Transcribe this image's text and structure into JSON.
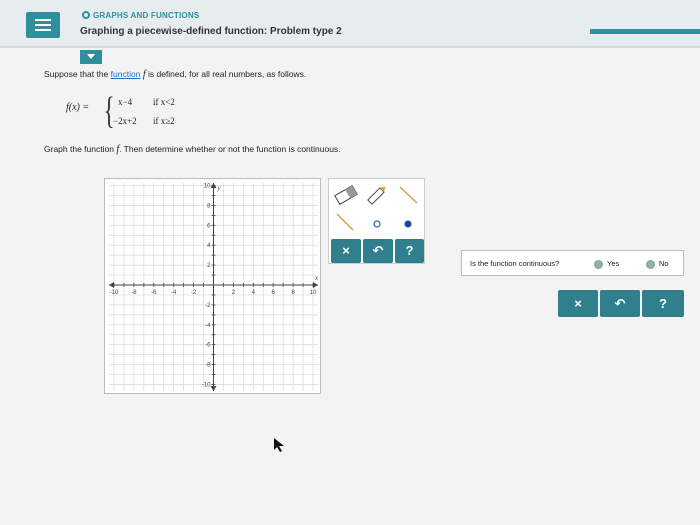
{
  "header": {
    "category": "GRAPHS AND FUNCTIONS",
    "title": "Graphing a piecewise-defined function: Problem type 2"
  },
  "problem": {
    "intro_pre": "Suppose that the",
    "intro_link": "function",
    "intro_var": "f",
    "intro_post": "is defined, for all real numbers, as follows.",
    "fx_label": "f(x) =",
    "piece1_expr": "x−4",
    "piece1_cond": "if x<2",
    "piece2_expr": "−2x+2",
    "piece2_cond": "if x≥2",
    "instruction_pre": "Graph the function",
    "instruction_var": "f",
    "instruction_post": ". Then determine whether or not the function is continuous."
  },
  "graph": {
    "x_axis_label": "x",
    "y_axis_label": "y",
    "x_ticks": [
      "-10",
      "-8",
      "-6",
      "-4",
      "-2",
      "2",
      "4",
      "6",
      "8",
      "10"
    ],
    "y_ticks": [
      "10",
      "8",
      "6",
      "4",
      "2",
      "-2",
      "-4",
      "-6",
      "-8",
      "-10"
    ],
    "range": [
      -10,
      10
    ],
    "grid": true
  },
  "tools": {
    "clear_label": "×",
    "undo_label": "↶",
    "help_label": "?"
  },
  "continuity": {
    "question": "Is the function continuous?",
    "yes_label": "Yes",
    "no_label": "No"
  },
  "answer_bar": {
    "clear_label": "×",
    "undo_label": "↶",
    "help_label": "?"
  },
  "colors": {
    "accent": "#2f8f9d",
    "button_dark": "#2f7f8c",
    "link": "#2a6fb5"
  }
}
